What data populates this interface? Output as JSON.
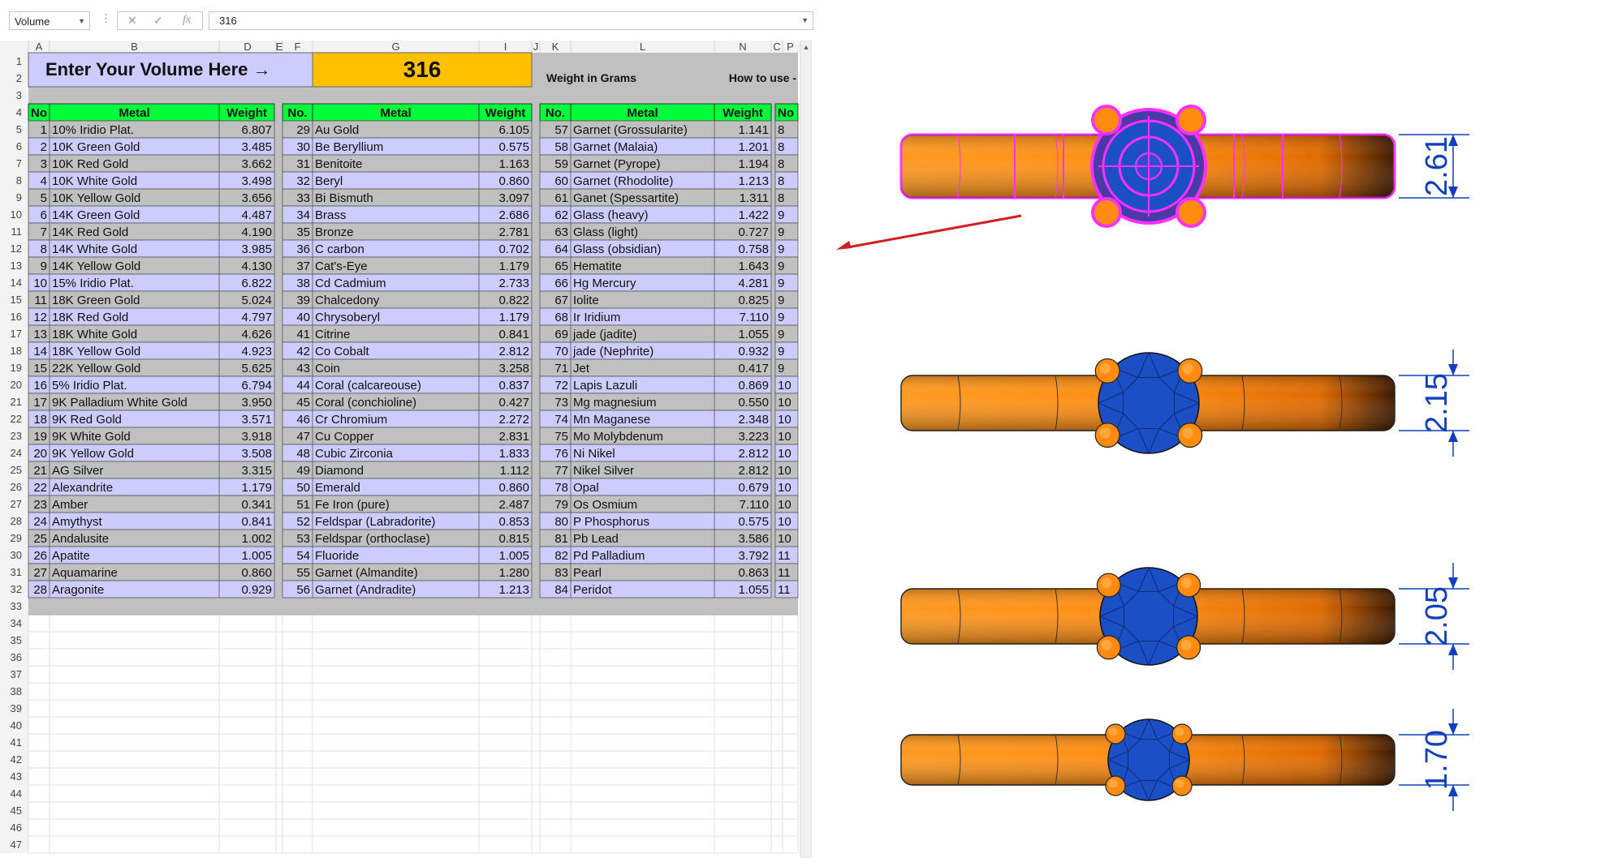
{
  "formula_bar": {
    "name_box": "Volume",
    "formula": "316",
    "fx": "fx"
  },
  "columns": [
    "A",
    "B",
    "D",
    "E",
    "F",
    "G",
    "I",
    "J",
    "K",
    "L",
    "N",
    "C",
    "P"
  ],
  "row_numbers": [
    1,
    2,
    3,
    4,
    5,
    6,
    7,
    8,
    9,
    10,
    11,
    12,
    13,
    14,
    15,
    16,
    17,
    18,
    19,
    20,
    21,
    22,
    23,
    24,
    25,
    26,
    27,
    28,
    29,
    30,
    31,
    32,
    33,
    34,
    35,
    36,
    37,
    38,
    39,
    40,
    41,
    42,
    43,
    44,
    45,
    46,
    47
  ],
  "banner": {
    "prompt": "Enter Your Volume Here  →",
    "volume": "316",
    "weight_label": "Weight in Grams",
    "how_to": "How to use -"
  },
  "headers": {
    "no": "No",
    "no_dot": "No.",
    "metal": "Metal",
    "weight": "Weight",
    "no_short": "No"
  },
  "block1": [
    [
      "1",
      "10% Iridio Plat.",
      "6.807"
    ],
    [
      "2",
      "10K Green Gold",
      "3.485"
    ],
    [
      "3",
      "10K Red Gold",
      "3.662"
    ],
    [
      "4",
      "10K White Gold",
      "3.498"
    ],
    [
      "5",
      "10K Yellow Gold",
      "3.656"
    ],
    [
      "6",
      "14K Green Gold",
      "4.487"
    ],
    [
      "7",
      "14K Red Gold",
      "4.190"
    ],
    [
      "8",
      "14K White Gold",
      "3.985"
    ],
    [
      "9",
      "14K Yellow Gold",
      "4.130"
    ],
    [
      "10",
      "15% Iridio Plat.",
      "6.822"
    ],
    [
      "11",
      "18K Green Gold",
      "5.024"
    ],
    [
      "12",
      "18K Red Gold",
      "4.797"
    ],
    [
      "13",
      "18K White Gold",
      "4.626"
    ],
    [
      "14",
      "18K Yellow Gold",
      "4.923"
    ],
    [
      "15",
      "22K Yellow Gold",
      "5.625"
    ],
    [
      "16",
      "5% Iridio Plat.",
      "6.794"
    ],
    [
      "17",
      "9K Palladium White Gold",
      "3.950"
    ],
    [
      "18",
      "9K Red Gold",
      "3.571"
    ],
    [
      "19",
      "9K White Gold",
      "3.918"
    ],
    [
      "20",
      "9K Yellow Gold",
      "3.508"
    ],
    [
      "21",
      "AG Silver",
      "3.315"
    ],
    [
      "22",
      "Alexandrite",
      "1.179"
    ],
    [
      "23",
      "Amber",
      "0.341"
    ],
    [
      "24",
      "Amythyst",
      "0.841"
    ],
    [
      "25",
      "Andalusite",
      "1.002"
    ],
    [
      "26",
      "Apatite",
      "1.005"
    ],
    [
      "27",
      "Aquamarine",
      "0.860"
    ],
    [
      "28",
      "Aragonite",
      "0.929"
    ]
  ],
  "block2": [
    [
      "29",
      "Au Gold",
      "6.105"
    ],
    [
      "30",
      "Be Beryllium",
      "0.575"
    ],
    [
      "31",
      "Benitoite",
      "1.163"
    ],
    [
      "32",
      "Beryl",
      "0.860"
    ],
    [
      "33",
      "Bi Bismuth",
      "3.097"
    ],
    [
      "34",
      "Brass",
      "2.686"
    ],
    [
      "35",
      "Bronze",
      "2.781"
    ],
    [
      "36",
      "C carbon",
      "0.702"
    ],
    [
      "37",
      "Cat's-Eye",
      "1.179"
    ],
    [
      "38",
      "Cd Cadmium",
      "2.733"
    ],
    [
      "39",
      "Chalcedony",
      "0.822"
    ],
    [
      "40",
      "Chrysoberyl",
      "1.179"
    ],
    [
      "41",
      "Citrine",
      "0.841"
    ],
    [
      "42",
      "Co Cobalt",
      "2.812"
    ],
    [
      "43",
      "Coin",
      "3.258"
    ],
    [
      "44",
      "Coral (calcareouse)",
      "0.837"
    ],
    [
      "45",
      "Coral (conchioline)",
      "0.427"
    ],
    [
      "46",
      "Cr Chromium",
      "2.272"
    ],
    [
      "47",
      "Cu Copper",
      "2.831"
    ],
    [
      "48",
      "Cubic Zirconia",
      "1.833"
    ],
    [
      "49",
      "Diamond",
      "1.112"
    ],
    [
      "50",
      "Emerald",
      "0.860"
    ],
    [
      "51",
      "Fe Iron (pure)",
      "2.487"
    ],
    [
      "52",
      "Feldspar (Labradorite)",
      "0.853"
    ],
    [
      "53",
      "Feldspar (orthoclase)",
      "0.815"
    ],
    [
      "54",
      "Fluoride",
      "1.005"
    ],
    [
      "55",
      "Garnet (Almandite)",
      "1.280"
    ],
    [
      "56",
      "Garnet (Andradite)",
      "1.213"
    ]
  ],
  "block3": [
    [
      "57",
      "Garnet (Grossularite)",
      "1.141"
    ],
    [
      "58",
      "Garnet (Malaia)",
      "1.201"
    ],
    [
      "59",
      "Garnet (Pyrope)",
      "1.194"
    ],
    [
      "60",
      "Garnet (Rhodolite)",
      "1.213"
    ],
    [
      "61",
      "Ganet (Spessartite)",
      "1.311"
    ],
    [
      "62",
      "Glass (heavy)",
      "1.422"
    ],
    [
      "63",
      "Glass (light)",
      "0.727"
    ],
    [
      "64",
      "Glass (obsidian)",
      "0.758"
    ],
    [
      "65",
      "Hematite",
      "1.643"
    ],
    [
      "66",
      "Hg Mercury",
      "4.281"
    ],
    [
      "67",
      "Iolite",
      "0.825"
    ],
    [
      "68",
      "Ir Iridium",
      "7.110"
    ],
    [
      "69",
      "jade (jadite)",
      "1.055"
    ],
    [
      "70",
      "jade (Nephrite)",
      "0.932"
    ],
    [
      "71",
      "Jet",
      "0.417"
    ],
    [
      "72",
      "Lapis Lazuli",
      "0.869"
    ],
    [
      "73",
      "Mg magnesium",
      "0.550"
    ],
    [
      "74",
      "Mn Maganese",
      "2.348"
    ],
    [
      "75",
      "Mo Molybdenum",
      "3.223"
    ],
    [
      "76",
      "Ni Nikel",
      "2.812"
    ],
    [
      "77",
      "Nikel Silver",
      "2.812"
    ],
    [
      "78",
      "Opal",
      "0.679"
    ],
    [
      "79",
      "Os Osmium",
      "7.110"
    ],
    [
      "80",
      "P Phosphorus",
      "0.575"
    ],
    [
      "81",
      "Pb Lead",
      "3.586"
    ],
    [
      "82",
      "Pd Palladium",
      "3.792"
    ],
    [
      "83",
      "Pearl",
      "0.863"
    ],
    [
      "84",
      "Peridot",
      "1.055"
    ]
  ],
  "block4_clipped": [
    "8",
    "8",
    "8",
    "8",
    "8",
    "9",
    "9",
    "9",
    "9",
    "9",
    "9",
    "9",
    "9",
    "9",
    "9",
    "10",
    "10",
    "10",
    "10",
    "10",
    "10",
    "10",
    "10",
    "10",
    "10",
    "11",
    "11",
    "11"
  ],
  "dimensions": [
    "2.61",
    "2.15",
    "2.05",
    "1.70"
  ],
  "colors": {
    "header_green": "#00ff3a",
    "row_blue": "#ccccff",
    "row_gray": "#c0c0c0",
    "banner_yellow": "#ffc000",
    "metal_orange": "#ff8c10",
    "stone_blue": "#1d4fc4",
    "highlight_magenta": "#ff30ff",
    "dim_blue": "#1040c0",
    "arrow_red": "#d02020"
  }
}
